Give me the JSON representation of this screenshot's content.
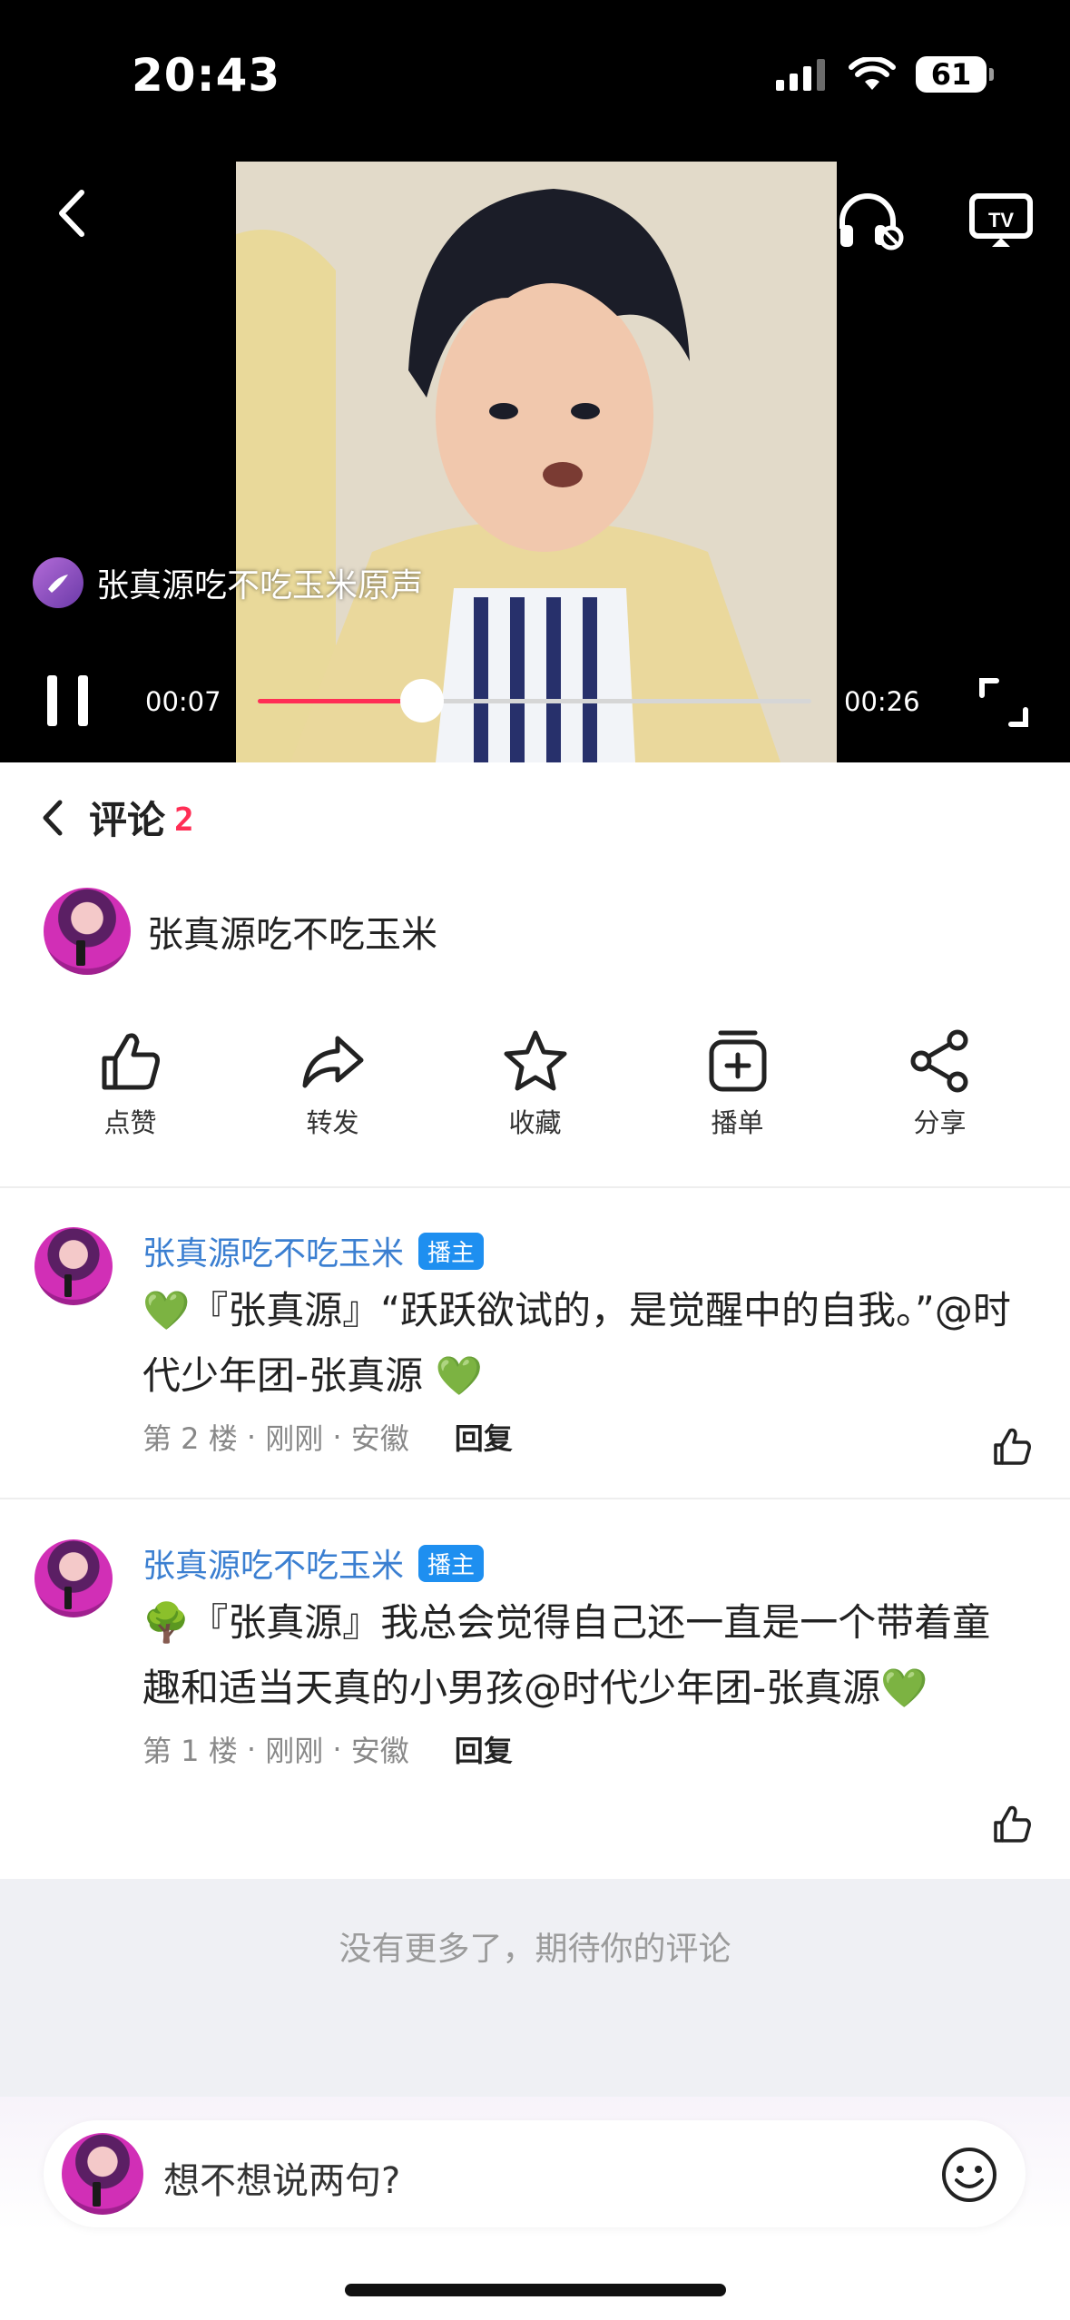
{
  "status_bar": {
    "time": "20:43",
    "battery": "61"
  },
  "player": {
    "sound_title": "张真源吃不吃玉米原声",
    "current_time": "00:07",
    "total_time": "00:26",
    "progress_fraction": 0.296
  },
  "comments_header": {
    "title": "评论",
    "count": "2"
  },
  "author": {
    "name": "张真源吃不吃玉米"
  },
  "actions": [
    {
      "label": "点赞",
      "icon": "thumb-up-icon"
    },
    {
      "label": "转发",
      "icon": "forward-icon"
    },
    {
      "label": "收藏",
      "icon": "star-icon"
    },
    {
      "label": "播单",
      "icon": "playlist-add-icon"
    },
    {
      "label": "分享",
      "icon": "share-icon"
    }
  ],
  "comments": [
    {
      "name": "张真源吃不吃玉米",
      "badge": "播主",
      "text": "💚『张真源』“跃跃欲试的，是觉醒中的自我。”@时代少年团-张真源 💚",
      "floor": "第 2 楼",
      "time": "刚刚",
      "location": "安徽",
      "reply": "回复"
    },
    {
      "name": "张真源吃不吃玉米",
      "badge": "播主",
      "text": "🌳『张真源』我总会觉得自己还一直是一个带着童趣和适当天真的小男孩@时代少年团-张真源💚",
      "floor": "第 1 楼",
      "time": "刚刚",
      "location": "安徽",
      "reply": "回复"
    }
  ],
  "no_more": "没有更多了，期待你的评论",
  "input": {
    "placeholder": "想不想说两句?"
  },
  "colors": {
    "accent": "#ff2e55",
    "link": "#3b7fd1",
    "badge": "#1e8ff0"
  }
}
